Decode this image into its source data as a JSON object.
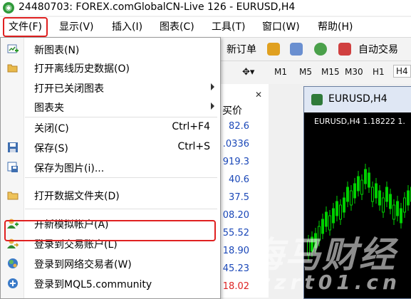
{
  "window": {
    "title": "24480703: FOREX.comGlobalCN-Live 126 - EURUSD,H4"
  },
  "menubar": {
    "items": [
      {
        "label": "文件(F)"
      },
      {
        "label": "显示(V)"
      },
      {
        "label": "插入(I)"
      },
      {
        "label": "图表(C)"
      },
      {
        "label": "工具(T)"
      },
      {
        "label": "窗口(W)"
      },
      {
        "label": "帮助(H)"
      }
    ]
  },
  "file_menu": {
    "items": [
      {
        "label": "新图表(N)",
        "icon": "new-chart-icon"
      },
      {
        "label": "打开离线历史数据(O)",
        "icon": "open-folder-icon"
      },
      {
        "label": "打开已关闭图表",
        "submenu": true
      },
      {
        "label": "图表夹",
        "submenu": true
      },
      {
        "label": "关闭(C)",
        "shortcut": "Ctrl+F4"
      },
      {
        "label": "保存(S)",
        "shortcut": "Ctrl+S",
        "icon": "save-icon"
      },
      {
        "label": "保存为图片(i)...",
        "icon": "save-picture-icon"
      },
      {
        "label": "打开数据文件夹(D)",
        "icon": "folder-icon"
      },
      {
        "label": "开新模拟帐户(A)",
        "icon": "add-user-icon"
      },
      {
        "label": "登录到交易账户(L)",
        "icon": "login-user-icon"
      },
      {
        "label": "登录到网络交易者(W)",
        "icon": "web-trader-icon"
      },
      {
        "label": "登录到MQL5.community",
        "icon": "mql5-icon"
      }
    ]
  },
  "toolbar": {
    "new_order": "新订单",
    "auto_trading": "自动交易",
    "timeframes": [
      "M1",
      "M5",
      "M15",
      "M30",
      "H1",
      "H4"
    ],
    "active_timeframe": "H4"
  },
  "market_watch": {
    "column": "买价",
    "prices": [
      {
        "value": "82.6"
      },
      {
        "value": ".0336"
      },
      {
        "value": "919.3"
      },
      {
        "value": "40.6"
      },
      {
        "value": "37.5"
      },
      {
        "value": "08.20"
      },
      {
        "value": "55.52"
      },
      {
        "value": "18.90"
      },
      {
        "value": "45.23"
      },
      {
        "value": "18.02"
      }
    ]
  },
  "chart": {
    "window_title": "EURUSD,H4",
    "header": "EURUSD,H4  1.18222  1."
  },
  "watermark": {
    "line1": "海马财经",
    "line2": "zzrt01.cn"
  },
  "colors": {
    "highlight": "#e02020",
    "price_blue": "#1b48b8",
    "candle": "#00d000",
    "chart_bg": "#000000"
  }
}
